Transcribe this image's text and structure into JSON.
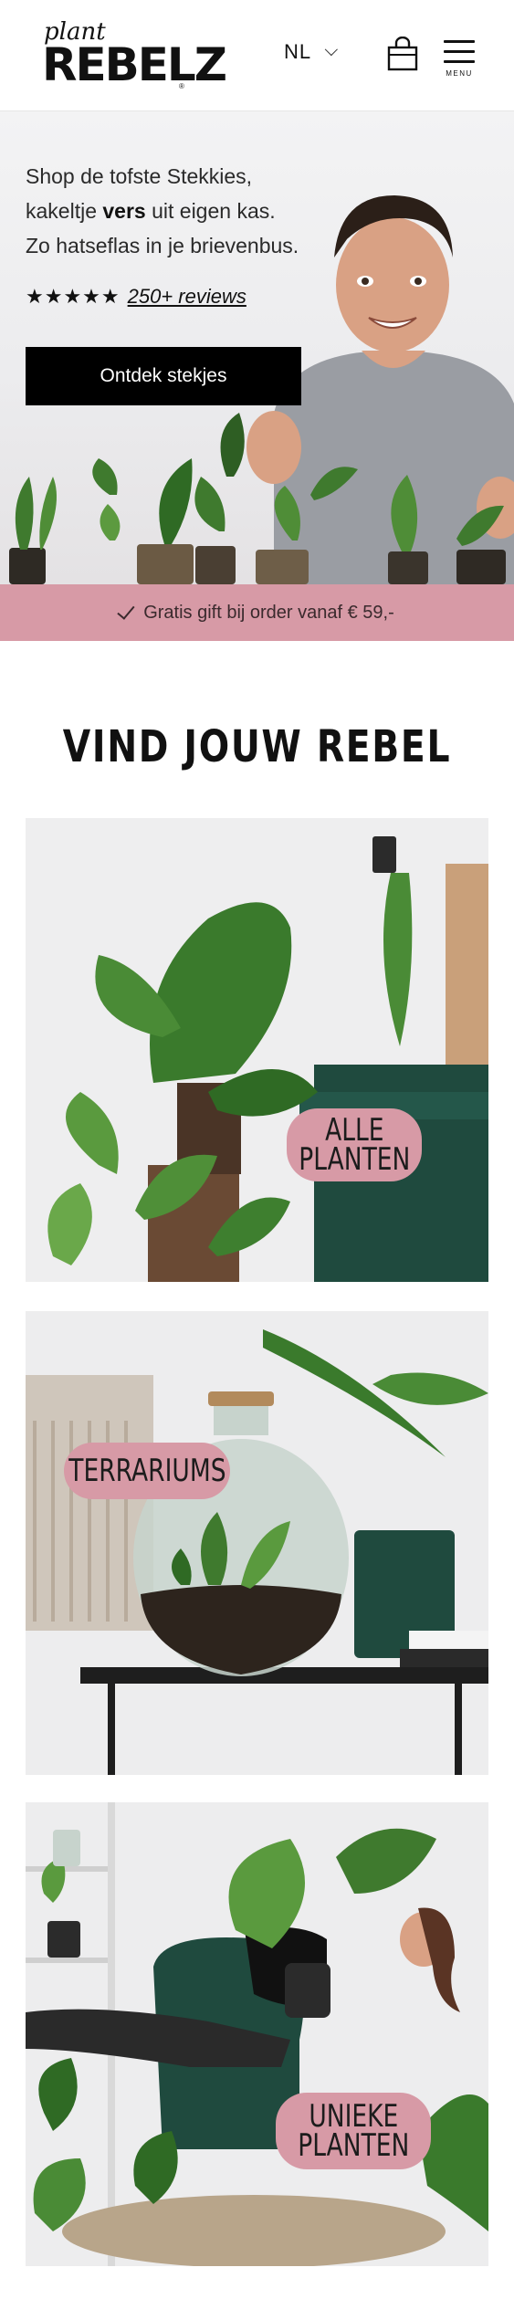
{
  "header": {
    "logo_small": "plant",
    "logo_big": "REBELZ",
    "logo_reg": "®",
    "language": "NL",
    "menu_label": "MENU"
  },
  "hero": {
    "line1": "Shop de tofste Stekkies,",
    "line2_pre": "kakeltje ",
    "line2_bold": "vers",
    "line2_post": " uit eigen kas.",
    "line3": "Zo hatseflas in je brievenbus.",
    "stars": "★★★★★",
    "reviews_link": "250+ reviews",
    "cta_label": "Ontdek stekjes"
  },
  "promo": {
    "text": "Gratis gift bij order vanaf € 59,-"
  },
  "section": {
    "title": "VIND JOUW REBEL"
  },
  "cards": [
    {
      "label": "ALLE\nPLANTEN"
    },
    {
      "label": "TERRARIUMS"
    },
    {
      "label": "UNIEKE\nPLANTEN"
    }
  ],
  "colors": {
    "accent_pink": "#d79aa6",
    "cta_black": "#000000",
    "plant_green": "#3f7a2e"
  }
}
